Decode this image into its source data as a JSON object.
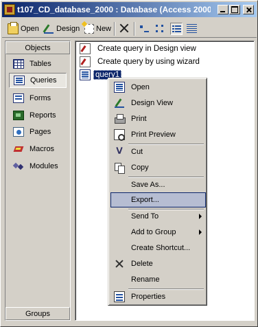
{
  "window": {
    "title": "t107_CD_database_2000 : Database (Access 2000 ..."
  },
  "toolbar": {
    "open_label": "Open",
    "design_label": "Design",
    "new_label": "New"
  },
  "sidebar": {
    "header": "Objects",
    "footer": "Groups",
    "items": [
      {
        "label": "Tables",
        "icon": "table-icon"
      },
      {
        "label": "Queries",
        "icon": "query-icon",
        "selected": true
      },
      {
        "label": "Forms",
        "icon": "form-icon"
      },
      {
        "label": "Reports",
        "icon": "report-icon"
      },
      {
        "label": "Pages",
        "icon": "page-icon"
      },
      {
        "label": "Macros",
        "icon": "macro-icon"
      },
      {
        "label": "Modules",
        "icon": "module-icon"
      }
    ]
  },
  "list": {
    "items": [
      {
        "label": "Create query in Design view"
      },
      {
        "label": "Create query by using wizard"
      },
      {
        "label": "query1",
        "selected": true
      }
    ]
  },
  "context_menu": {
    "items": [
      {
        "label": "Open"
      },
      {
        "label": "Design View"
      },
      {
        "label": "Print"
      },
      {
        "label": "Print Preview"
      },
      {
        "label": "Cut"
      },
      {
        "label": "Copy"
      },
      {
        "label": "Save As..."
      },
      {
        "label": "Export...",
        "highlighted": true
      },
      {
        "label": "Send To",
        "submenu": true
      },
      {
        "label": "Add to Group",
        "submenu": true
      },
      {
        "label": "Create Shortcut..."
      },
      {
        "label": "Delete"
      },
      {
        "label": "Rename"
      },
      {
        "label": "Properties"
      }
    ]
  },
  "colors": {
    "title_bar": "#0a246a",
    "selection": "#0a246a",
    "menu_highlight": "#b6bdd2",
    "face": "#d4d0c8"
  }
}
